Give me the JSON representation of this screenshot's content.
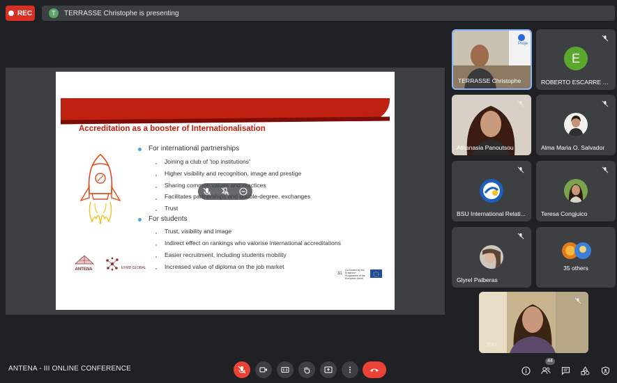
{
  "top": {
    "rec_label": "REC",
    "presenter_initial": "T",
    "presenting_text": "TERRASSE Christophe is presenting"
  },
  "slide": {
    "title": "Accreditation as a booster of Internationalisation",
    "sections": [
      {
        "heading": "For international partnerships",
        "items": [
          "Joining a club of 'top institutions'",
          "Higher visibility and recognition, image and prestige",
          "Sharing common values and practices",
          "Facilitates partnerships and double-degree, exchanges",
          "Trust"
        ]
      },
      {
        "heading": "For students",
        "items": [
          "Trust, visibility and image",
          "Indirect effect on rankings who valorise international accreditations",
          "Easier recruitment, including students mobility",
          "Increased value of diploma on the job market"
        ]
      }
    ],
    "page_number": "31",
    "eu_text": "Co-funded by the Erasmus+ Programme of the European Union",
    "logo_antena": "ANTENA",
    "logo_efmd": "EFMD GLOBAL"
  },
  "participants": [
    {
      "name": "TERRASSE Christophe",
      "muted": false,
      "kind": "video",
      "overlay_text": "Proje"
    },
    {
      "name": "ROBERTO ESCARRE UR...",
      "muted": true,
      "kind": "letter",
      "initial": "E",
      "color": "#5aa82c"
    },
    {
      "name": "Athanasia Panoutsou",
      "muted": true,
      "kind": "video"
    },
    {
      "name": "Alma Maria O. Salvador",
      "muted": true,
      "kind": "avatar"
    },
    {
      "name": "BSU International Relati...",
      "muted": true,
      "kind": "avatar"
    },
    {
      "name": "Teresa Congjuico",
      "muted": true,
      "kind": "avatar"
    },
    {
      "name": "Glyrel Palberas",
      "muted": true,
      "kind": "avatar"
    },
    {
      "name": "35 others",
      "kind": "group"
    },
    {
      "name": "You",
      "muted": true,
      "kind": "self"
    }
  ],
  "bottom": {
    "meeting_name": "ANTENA - III ONLINE CONFERENCE",
    "people_count": "44"
  },
  "colors": {
    "background": "#202124",
    "tile": "#3c4043",
    "danger": "#ea4335",
    "slide_red": "#c0200f",
    "bullet_blue": "#4aa3df"
  }
}
